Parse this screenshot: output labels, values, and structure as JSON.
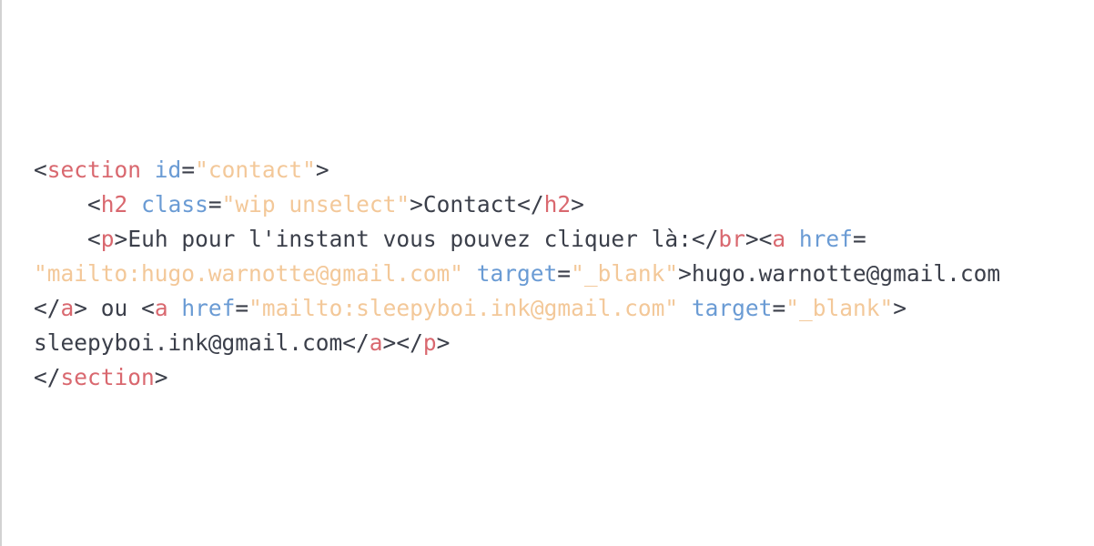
{
  "editor": {
    "colors": {
      "background": "#ffffff",
      "punctuation_and_text": "#3b3f4a",
      "tag_name": "#d9686f",
      "attribute_name": "#6a9bd4",
      "attribute_value": "#f3c899",
      "gutter_rule": "#d2d2d2"
    },
    "lines": [
      [
        {
          "t": "<",
          "k": "pun"
        },
        {
          "t": "section",
          "k": "tag"
        },
        {
          "t": " ",
          "k": "txt"
        },
        {
          "t": "id",
          "k": "attr"
        },
        {
          "t": "=",
          "k": "pun"
        },
        {
          "t": "\"contact\"",
          "k": "str"
        },
        {
          "t": ">",
          "k": "pun"
        }
      ],
      [
        {
          "t": "    ",
          "k": "txt"
        },
        {
          "t": "<",
          "k": "pun"
        },
        {
          "t": "h2",
          "k": "tag"
        },
        {
          "t": " ",
          "k": "txt"
        },
        {
          "t": "class",
          "k": "attr"
        },
        {
          "t": "=",
          "k": "pun"
        },
        {
          "t": "\"wip unselect\"",
          "k": "str"
        },
        {
          "t": ">",
          "k": "pun"
        },
        {
          "t": "Contact",
          "k": "txt"
        },
        {
          "t": "</",
          "k": "pun"
        },
        {
          "t": "h2",
          "k": "tag"
        },
        {
          "t": ">",
          "k": "pun"
        }
      ],
      [
        {
          "t": "    ",
          "k": "txt"
        },
        {
          "t": "<",
          "k": "pun"
        },
        {
          "t": "p",
          "k": "tag"
        },
        {
          "t": ">",
          "k": "pun"
        },
        {
          "t": "Euh pour l'instant vous pouvez cliquer là:",
          "k": "txt"
        },
        {
          "t": "</",
          "k": "pun"
        },
        {
          "t": "br",
          "k": "tag"
        },
        {
          "t": ">",
          "k": "pun"
        },
        {
          "t": "<",
          "k": "pun"
        },
        {
          "t": "a",
          "k": "tag"
        },
        {
          "t": " ",
          "k": "txt"
        },
        {
          "t": "href",
          "k": "attr"
        },
        {
          "t": "=",
          "k": "pun"
        }
      ],
      [
        {
          "t": "\"mailto:hugo.warnotte@gmail.com\"",
          "k": "str"
        },
        {
          "t": " ",
          "k": "txt"
        },
        {
          "t": "target",
          "k": "attr"
        },
        {
          "t": "=",
          "k": "pun"
        },
        {
          "t": "\"_blank\"",
          "k": "str"
        },
        {
          "t": ">",
          "k": "pun"
        },
        {
          "t": "hugo.warnotte@gmail.com",
          "k": "txt"
        }
      ],
      [
        {
          "t": "</",
          "k": "pun"
        },
        {
          "t": "a",
          "k": "tag"
        },
        {
          "t": ">",
          "k": "pun"
        },
        {
          "t": " ou ",
          "k": "txt"
        },
        {
          "t": "<",
          "k": "pun"
        },
        {
          "t": "a",
          "k": "tag"
        },
        {
          "t": " ",
          "k": "txt"
        },
        {
          "t": "href",
          "k": "attr"
        },
        {
          "t": "=",
          "k": "pun"
        },
        {
          "t": "\"mailto:sleepyboi.ink@gmail.com\"",
          "k": "str"
        },
        {
          "t": " ",
          "k": "txt"
        },
        {
          "t": "target",
          "k": "attr"
        },
        {
          "t": "=",
          "k": "pun"
        },
        {
          "t": "\"_blank\"",
          "k": "str"
        },
        {
          "t": ">",
          "k": "pun"
        }
      ],
      [
        {
          "t": "sleepyboi.ink@gmail.com",
          "k": "txt"
        },
        {
          "t": "</",
          "k": "pun"
        },
        {
          "t": "a",
          "k": "tag"
        },
        {
          "t": ">",
          "k": "pun"
        },
        {
          "t": "</",
          "k": "pun"
        },
        {
          "t": "p",
          "k": "tag"
        },
        {
          "t": ">",
          "k": "pun"
        }
      ],
      [
        {
          "t": "</",
          "k": "pun"
        },
        {
          "t": "section",
          "k": "tag"
        },
        {
          "t": ">",
          "k": "pun"
        }
      ]
    ]
  }
}
